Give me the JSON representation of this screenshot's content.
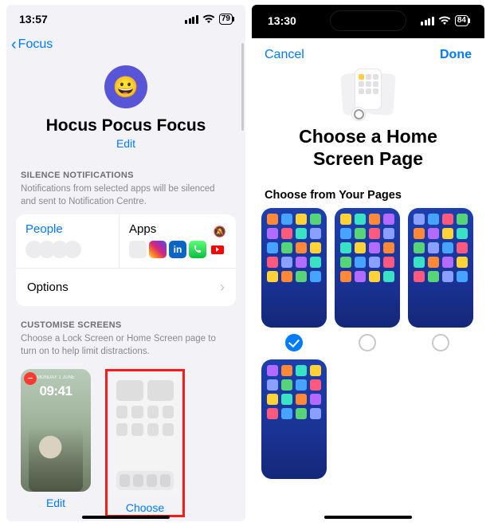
{
  "left": {
    "status": {
      "time": "13:57",
      "battery": "79"
    },
    "back_label": "Focus",
    "focus": {
      "icon": "😀",
      "title": "Hocus Pocus Focus",
      "edit": "Edit"
    },
    "silence": {
      "header": "SILENCE NOTIFICATIONS",
      "sub": "Notifications from selected apps will be silenced and sent to Notification Centre.",
      "people_label": "People",
      "apps_label": "Apps",
      "options_label": "Options"
    },
    "customise": {
      "header": "CUSTOMISE SCREENS",
      "sub": "Choose a Lock Screen or Home Screen page to turn on to help limit distractions.",
      "lock_time": "09:41",
      "edit_label": "Edit",
      "choose_label": "Choose"
    }
  },
  "right": {
    "status": {
      "time": "13:30",
      "battery": "84"
    },
    "cancel": "Cancel",
    "done": "Done",
    "title": "Choose a Home Screen Page",
    "subheader": "Choose from Your Pages",
    "pages": [
      {
        "selected": true
      },
      {
        "selected": false
      },
      {
        "selected": false
      },
      {
        "selected": false
      }
    ]
  }
}
